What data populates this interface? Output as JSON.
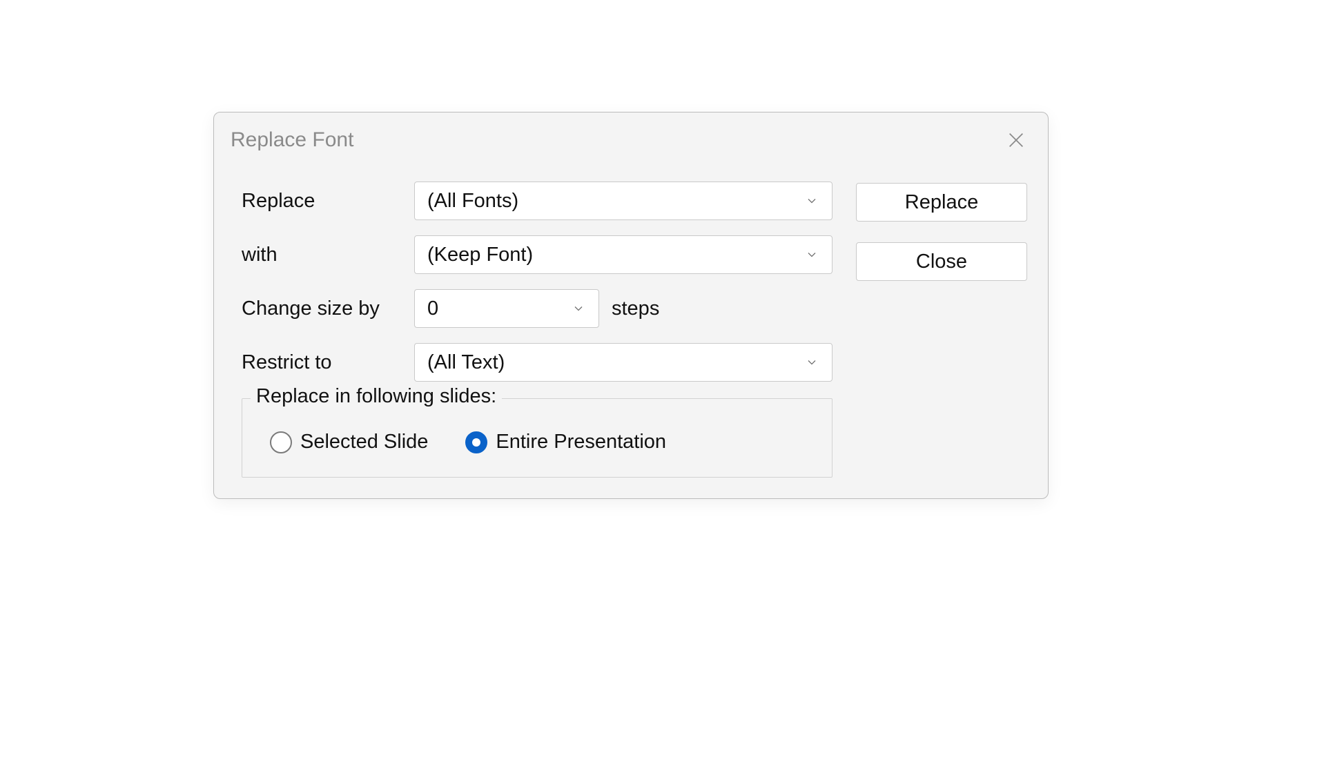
{
  "dialog": {
    "title": "Replace Font",
    "labels": {
      "replace": "Replace",
      "with": "with",
      "change_size_by": "Change size by",
      "steps": "steps",
      "restrict_to": "Restrict to"
    },
    "values": {
      "replace_font": "(All Fonts)",
      "with_font": "(Keep Font)",
      "size_steps": "0",
      "restrict_to": "(All Text)"
    },
    "fieldset": {
      "legend": "Replace in following slides:",
      "options": {
        "selected_slide": "Selected Slide",
        "entire_presentation": "Entire Presentation"
      },
      "selected": "entire_presentation"
    },
    "buttons": {
      "replace": "Replace",
      "close": "Close"
    }
  }
}
